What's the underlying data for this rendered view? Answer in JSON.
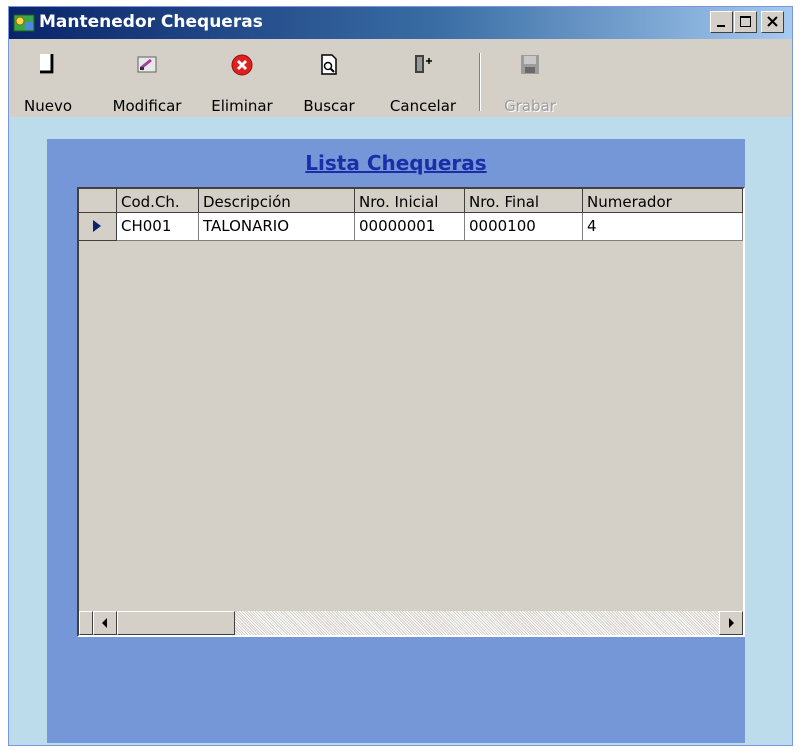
{
  "window": {
    "title": "Mantenedor Chequeras"
  },
  "toolbar": {
    "buttons": [
      {
        "label": "Nuevo",
        "icon": "new-document-icon",
        "enabled": true
      },
      {
        "label": "Modificar",
        "icon": "edit-icon",
        "enabled": true
      },
      {
        "label": "Eliminar",
        "icon": "delete-icon",
        "enabled": true
      },
      {
        "label": "Buscar",
        "icon": "search-icon",
        "enabled": true
      },
      {
        "label": "Cancelar",
        "icon": "exit-door-icon",
        "enabled": true
      },
      {
        "label": "Grabar",
        "icon": "save-icon",
        "enabled": false
      }
    ]
  },
  "list": {
    "title": "Lista Chequeras",
    "columns": [
      "Cod.Ch.",
      "Descripción",
      "Nro. Inicial",
      "Nro. Final",
      "Numerador"
    ],
    "rows": [
      [
        "CH001",
        "TALONARIO",
        "00000001",
        "0000100",
        "4"
      ]
    ]
  },
  "colors": {
    "titlebar_start": "#0a246a",
    "client_bg": "#bcdcec",
    "panel_bg": "#7597d7",
    "list_title": "#1a2ea8"
  }
}
